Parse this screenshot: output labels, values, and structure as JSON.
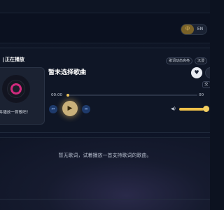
{
  "header": {
    "lang_toggle": {
      "options": [
        "中",
        "EN"
      ],
      "active": "中"
    }
  },
  "player": {
    "section_label": "正在播放",
    "cover_hint": "择并播放一首歌吧！",
    "song_title": "暂未选择歌曲",
    "tags": [
      "歌词动态高亮",
      "沉浸"
    ],
    "side_chip": "交",
    "time_now": "00:00",
    "time_total": "00",
    "progress": 0,
    "volume": 0.92,
    "icons": {
      "favorite": "heart-icon",
      "prev": "previous-icon",
      "play": "play-icon",
      "next": "next-icon",
      "volume": "volume-icon"
    }
  },
  "lyrics": {
    "empty_text": "暂无歌词，试着播放一首支持歌词的歌曲。"
  },
  "colors": {
    "accent": "#f0c24a",
    "background": "#0e1524",
    "vinyl_accent": "#d12a7d"
  }
}
